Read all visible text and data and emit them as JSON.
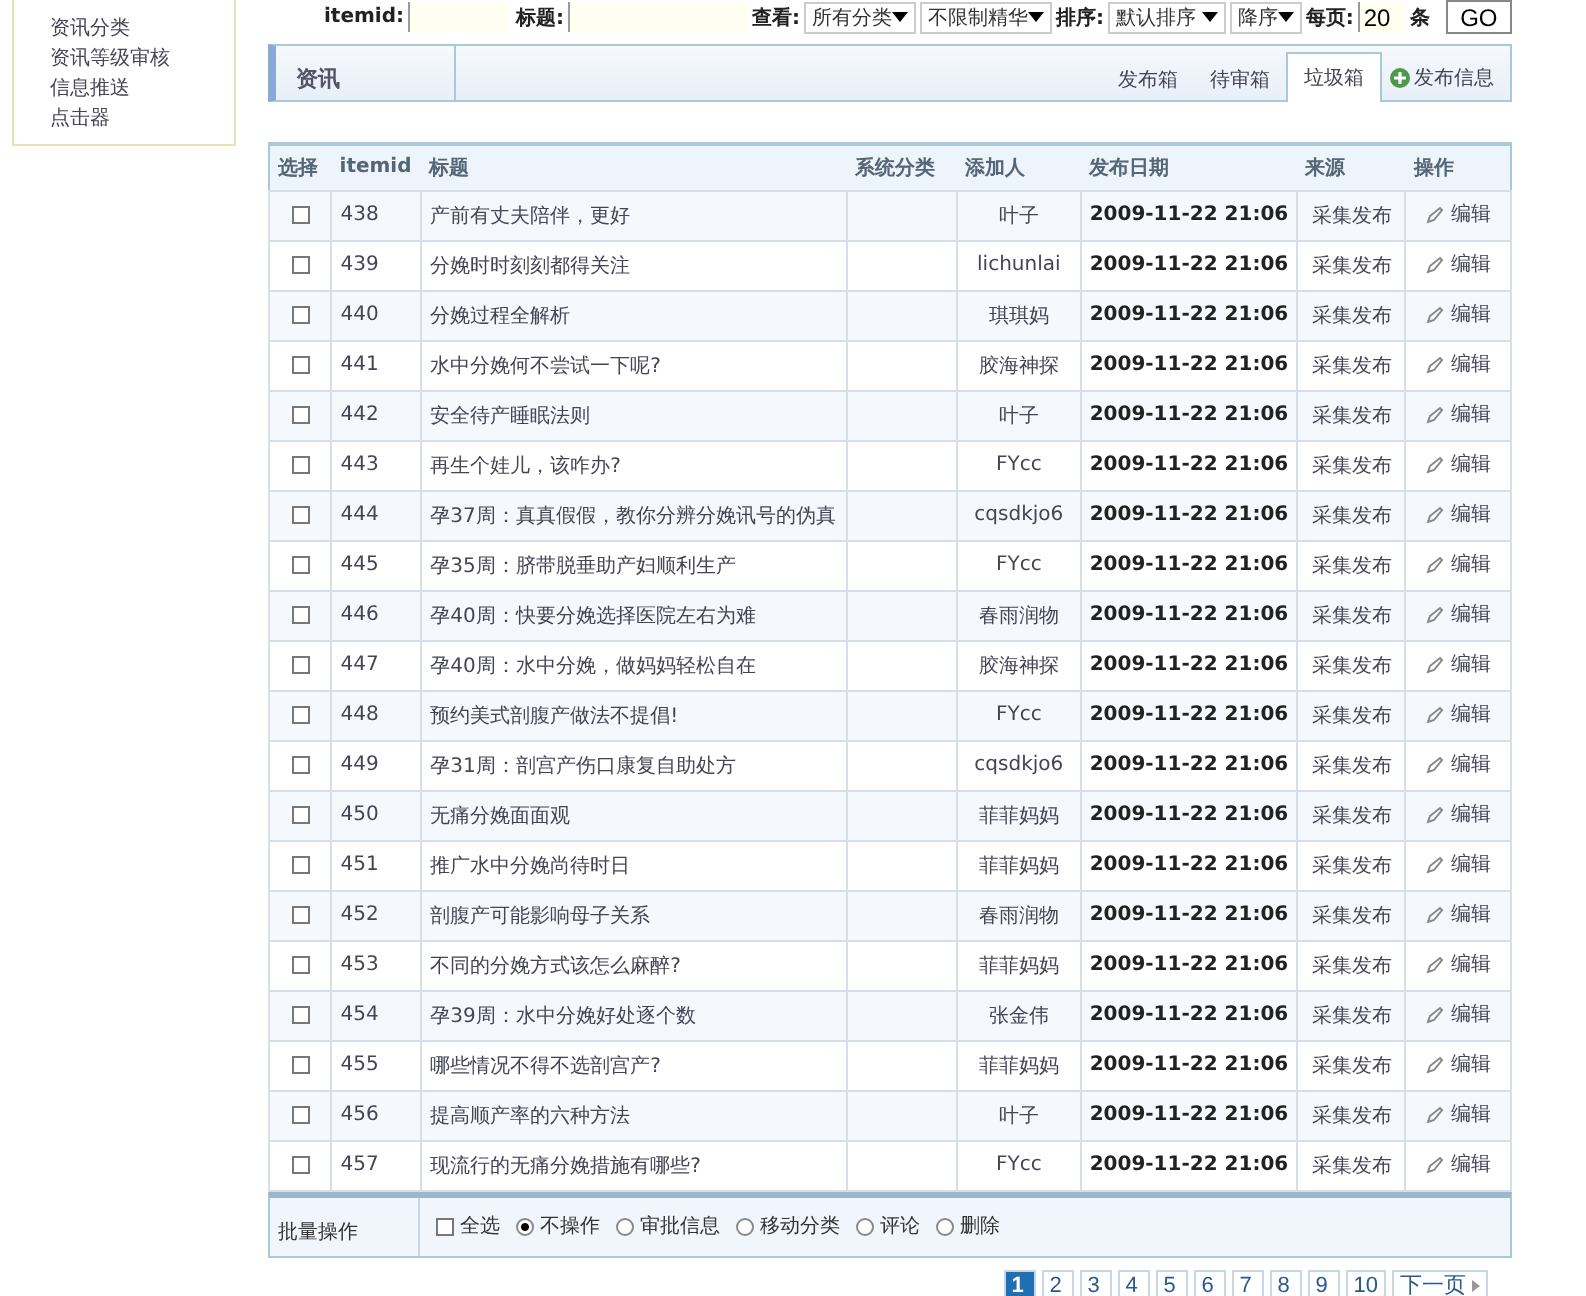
{
  "sidebar": {
    "items": [
      "资讯分类",
      "资讯等级审核",
      "信息推送",
      "点击器"
    ]
  },
  "filters": {
    "itemid_label": "itemid:",
    "title_label": "标题:",
    "view_label": "查看:",
    "category": "所有分类",
    "featured": "不限制精华",
    "sort_label": "排序:",
    "sort": "默认排序",
    "order": "降序",
    "per_page_label": "每页:",
    "per_page": "20",
    "per_page_unit": "条",
    "go": "GO"
  },
  "panel": {
    "title": "资讯",
    "tabs": [
      {
        "label": "发布箱",
        "selected": false
      },
      {
        "label": "待审箱",
        "selected": false
      },
      {
        "label": "垃圾箱",
        "selected": true
      }
    ],
    "add_button": "发布信息"
  },
  "table": {
    "columns": [
      "选择",
      "itemid",
      "标题",
      "系统分类",
      "添加人",
      "发布日期",
      "来源",
      "操作"
    ],
    "rows": [
      {
        "checked": false,
        "itemid": "438",
        "title": "产前有丈夫陪伴，更好",
        "author": "叶子",
        "date": "2009-11-22 21:06",
        "source": "采集发布",
        "action": "编辑"
      },
      {
        "checked": false,
        "itemid": "439",
        "title": "分娩时时刻刻都得关注",
        "author": "lichunlai",
        "date": "2009-11-22 21:06",
        "source": "采集发布",
        "action": "编辑"
      },
      {
        "checked": false,
        "itemid": "440",
        "title": "分娩过程全解析",
        "author": "琪琪妈",
        "date": "2009-11-22 21:06",
        "source": "采集发布",
        "action": "编辑"
      },
      {
        "checked": false,
        "itemid": "441",
        "title": "水中分娩何不尝试一下呢?",
        "author": "胶海神探",
        "date": "2009-11-22 21:06",
        "source": "采集发布",
        "action": "编辑"
      },
      {
        "checked": false,
        "itemid": "442",
        "title": "安全待产睡眠法则",
        "author": "叶子",
        "date": "2009-11-22 21:06",
        "source": "采集发布",
        "action": "编辑"
      },
      {
        "checked": false,
        "itemid": "443",
        "title": "再生个娃儿，该咋办?",
        "author": "FYcc",
        "date": "2009-11-22 21:06",
        "source": "采集发布",
        "action": "编辑"
      },
      {
        "checked": false,
        "itemid": "444",
        "title": "孕37周：真真假假，教你分辨分娩讯号的伪真",
        "author": "cqsdkjo6",
        "date": "2009-11-22 21:06",
        "source": "采集发布",
        "action": "编辑"
      },
      {
        "checked": false,
        "itemid": "445",
        "title": "孕35周：脐带脱垂助产妇顺利生产",
        "author": "FYcc",
        "date": "2009-11-22 21:06",
        "source": "采集发布",
        "action": "编辑"
      },
      {
        "checked": false,
        "itemid": "446",
        "title": "孕40周：快要分娩选择医院左右为难",
        "author": "春雨润物",
        "date": "2009-11-22 21:06",
        "source": "采集发布",
        "action": "编辑"
      },
      {
        "checked": false,
        "itemid": "447",
        "title": "孕40周：水中分娩，做妈妈轻松自在",
        "author": "胶海神探",
        "date": "2009-11-22 21:06",
        "source": "采集发布",
        "action": "编辑"
      },
      {
        "checked": false,
        "itemid": "448",
        "title": "预约美式剖腹产做法不提倡!",
        "author": "FYcc",
        "date": "2009-11-22 21:06",
        "source": "采集发布",
        "action": "编辑"
      },
      {
        "checked": false,
        "itemid": "449",
        "title": "孕31周：剖宫产伤口康复自助处方",
        "author": "cqsdkjo6",
        "date": "2009-11-22 21:06",
        "source": "采集发布",
        "action": "编辑"
      },
      {
        "checked": false,
        "itemid": "450",
        "title": "无痛分娩面面观",
        "author": "菲菲妈妈",
        "date": "2009-11-22 21:06",
        "source": "采集发布",
        "action": "编辑"
      },
      {
        "checked": false,
        "itemid": "451",
        "title": "推广水中分娩尚待时日",
        "author": "菲菲妈妈",
        "date": "2009-11-22 21:06",
        "source": "采集发布",
        "action": "编辑"
      },
      {
        "checked": false,
        "itemid": "452",
        "title": "剖腹产可能影响母子关系",
        "author": "春雨润物",
        "date": "2009-11-22 21:06",
        "source": "采集发布",
        "action": "编辑"
      },
      {
        "checked": false,
        "itemid": "453",
        "title": "不同的分娩方式该怎么麻醉?",
        "author": "菲菲妈妈",
        "date": "2009-11-22 21:06",
        "source": "采集发布",
        "action": "编辑"
      },
      {
        "checked": false,
        "itemid": "454",
        "title": "孕39周：水中分娩好处逐个数",
        "author": "张金伟",
        "date": "2009-11-22 21:06",
        "source": "采集发布",
        "action": "编辑"
      },
      {
        "checked": false,
        "itemid": "455",
        "title": "哪些情况不得不选剖宫产?",
        "author": "菲菲妈妈",
        "date": "2009-11-22 21:06",
        "source": "采集发布",
        "action": "编辑"
      },
      {
        "checked": false,
        "itemid": "456",
        "title": "提高顺产率的六种方法",
        "author": "叶子",
        "date": "2009-11-22 21:06",
        "source": "采集发布",
        "action": "编辑"
      },
      {
        "checked": false,
        "itemid": "457",
        "title": "现流行的无痛分娩措施有哪些?",
        "author": "FYcc",
        "date": "2009-11-22 21:06",
        "source": "采集发布",
        "action": "编辑"
      }
    ]
  },
  "batch": {
    "label": "批量操作",
    "select_all": {
      "label": "全选",
      "checked": false
    },
    "options": [
      {
        "label": "不操作",
        "selected": true
      },
      {
        "label": "审批信息",
        "selected": false
      },
      {
        "label": "移动分类",
        "selected": false
      },
      {
        "label": "评论",
        "selected": false
      },
      {
        "label": "删除",
        "selected": false
      }
    ]
  },
  "pagination": {
    "pages": [
      {
        "label": "1",
        "selected": true
      },
      {
        "label": "2",
        "selected": false
      },
      {
        "label": "3",
        "selected": false
      },
      {
        "label": "4",
        "selected": false
      },
      {
        "label": "5",
        "selected": false
      },
      {
        "label": "6",
        "selected": false
      },
      {
        "label": "7",
        "selected": false
      },
      {
        "label": "8",
        "selected": false
      },
      {
        "label": "9",
        "selected": false
      },
      {
        "label": "10",
        "selected": false
      }
    ],
    "next": "下一页"
  }
}
